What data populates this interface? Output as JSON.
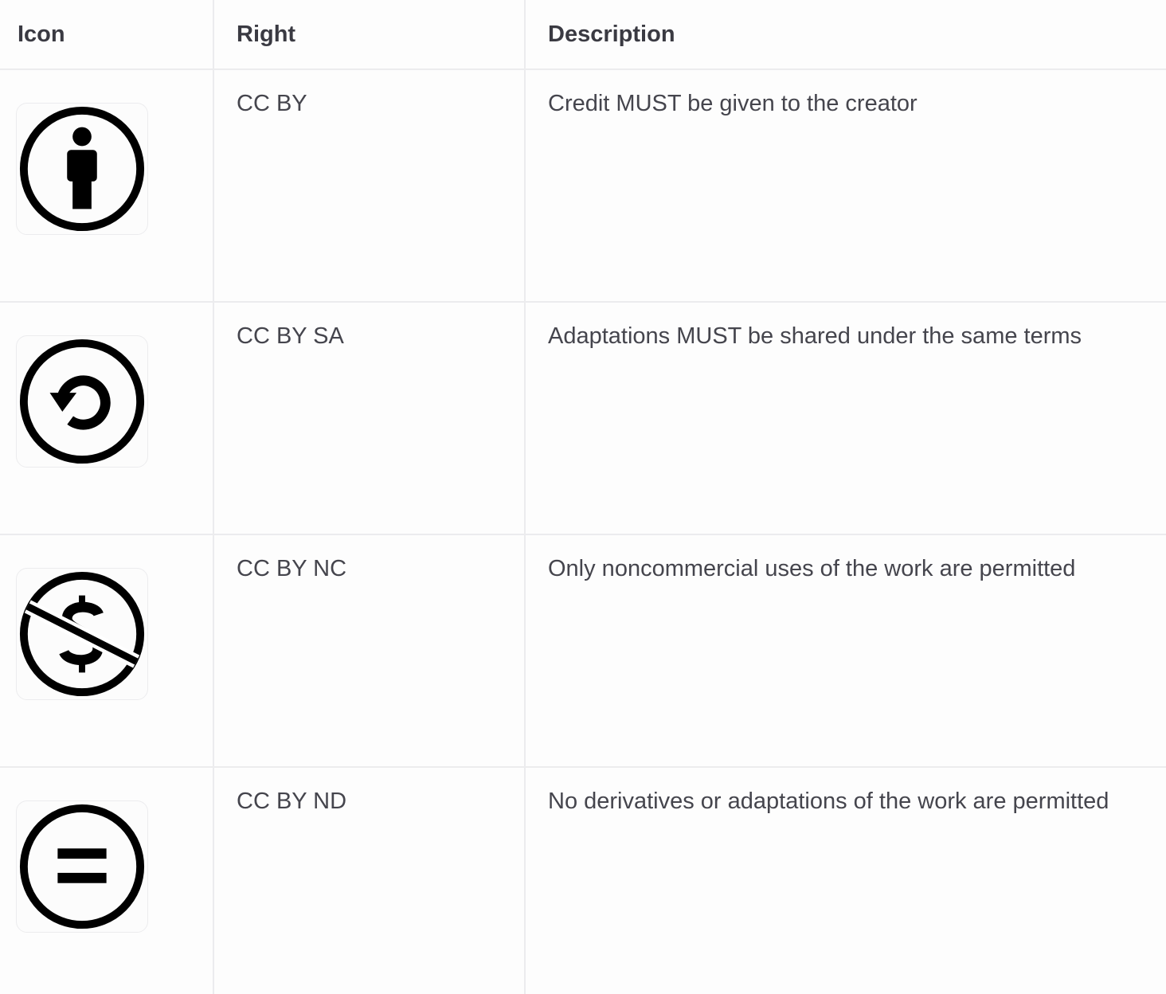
{
  "table": {
    "headers": {
      "icon": "Icon",
      "right": "Right",
      "description": "Description"
    },
    "rows": [
      {
        "icon": "cc-by-attribution-icon",
        "right": "CC BY",
        "description": "Credit MUST be given to the creator"
      },
      {
        "icon": "cc-sa-share-alike-icon",
        "right": "CC BY SA",
        "description": "Adaptations MUST be shared under the same terms"
      },
      {
        "icon": "cc-nc-noncommercial-icon",
        "right": "CC BY NC",
        "description": "Only noncommercial uses of the work are permitted"
      },
      {
        "icon": "cc-nd-no-derivatives-icon",
        "right": "CC BY ND",
        "description": "No derivatives or adaptations of the work are permitted"
      }
    ]
  },
  "colors": {
    "text": "#45454d",
    "header_text": "#3a3a42",
    "border": "#ececee",
    "icon": "#000000"
  }
}
